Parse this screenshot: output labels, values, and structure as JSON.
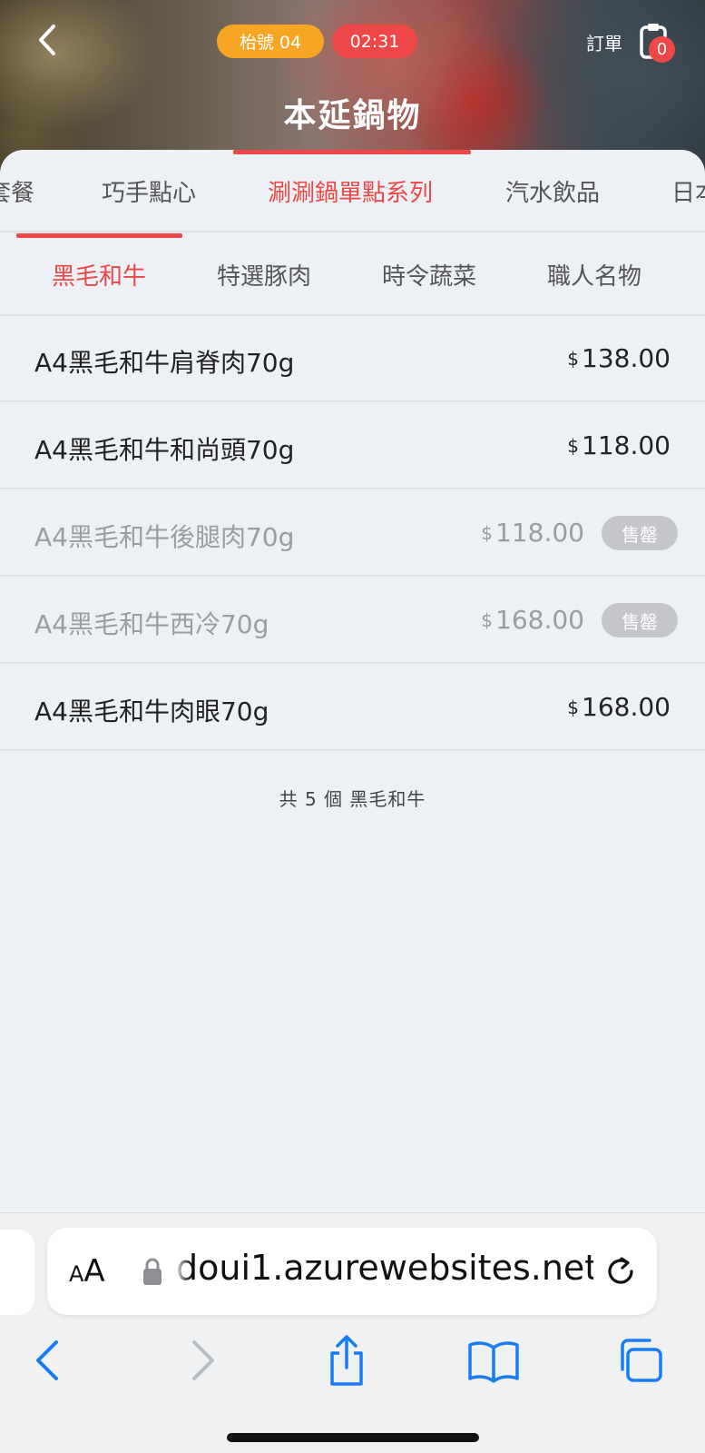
{
  "header": {
    "table_label": "枱號 04",
    "timer": "02:31",
    "orders_label": "訂單",
    "cart_count": "0",
    "store_name": "本延鍋物"
  },
  "category_tabs": [
    {
      "label": "套餐",
      "active": false
    },
    {
      "label": "巧手點心",
      "active": false
    },
    {
      "label": "涮涮鍋單點系列",
      "active": true
    },
    {
      "label": "汽水飲品",
      "active": false
    },
    {
      "label": "日本",
      "active": false
    }
  ],
  "sub_tabs": [
    {
      "label": "黑毛和牛",
      "active": true
    },
    {
      "label": "特選豚肉",
      "active": false
    },
    {
      "label": "時令蔬菜",
      "active": false
    },
    {
      "label": "職人名物",
      "active": false
    }
  ],
  "items": [
    {
      "name": "A4黑毛和牛肩脊肉70g",
      "currency": "$",
      "price": "138.00",
      "sold_out": false
    },
    {
      "name": "A4黑毛和牛和尚頭70g",
      "currency": "$",
      "price": "118.00",
      "sold_out": false
    },
    {
      "name": "A4黑毛和牛後腿肉70g",
      "currency": "$",
      "price": "118.00",
      "sold_out": true,
      "badge": "售罄"
    },
    {
      "name": "A4黑毛和牛西冷70g",
      "currency": "$",
      "price": "168.00",
      "sold_out": true,
      "badge": "售罄"
    },
    {
      "name": "A4黑毛和牛肉眼70g",
      "currency": "$",
      "price": "168.00",
      "sold_out": false
    }
  ],
  "item_count_text": "共 5 個 黑毛和牛",
  "browser": {
    "aa_small": "A",
    "aa_large": "A",
    "url": "doui1.azurewebsites.net"
  },
  "colors": {
    "accent": "#ee4748",
    "table_pill": "#f6a623",
    "toolbar_blue": "#1a7cf5"
  }
}
